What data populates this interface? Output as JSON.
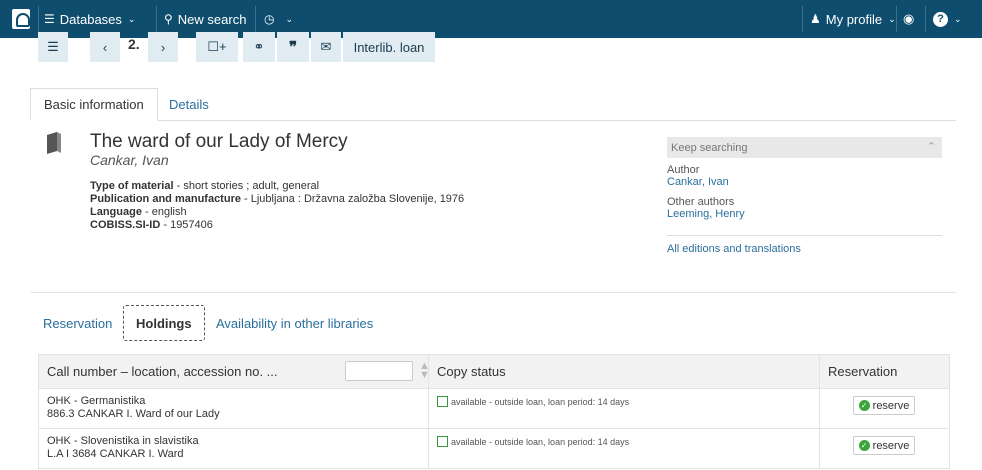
{
  "nav": {
    "databases": "Databases",
    "new_search": "New search",
    "my_profile": "My profile"
  },
  "toolbar": {
    "page": "2.",
    "interlib": "Interlib. loan"
  },
  "tabs_top": [
    "Basic information",
    "Details"
  ],
  "record": {
    "title": "The ward of our Lady of Mercy",
    "author": "Cankar, Ivan",
    "meta": [
      {
        "label": "Type of material",
        "value": " - short stories ; adult, general"
      },
      {
        "label": "Publication and manufacture",
        "value": " - Ljubljana : Državna založba Slovenije, 1976"
      },
      {
        "label": "Language",
        "value": " - english"
      },
      {
        "label": "COBISS.SI-ID",
        "value": " - 1957406"
      }
    ]
  },
  "side_panel": {
    "keep_searching": "Keep searching",
    "author_label": "Author",
    "author": "Cankar, Ivan",
    "other_label": "Other authors",
    "other": "Leeming, Henry",
    "all_editions": "All editions and translations"
  },
  "tabs_bottom": [
    "Reservation",
    "Holdings",
    "Availability in other libraries"
  ],
  "table": {
    "headers": [
      "Call number – location, accession no. ...",
      "Copy status",
      "Reservation"
    ],
    "rows": [
      {
        "loc1": "OHK - Germanistika",
        "loc2": "886.3 CANKAR I. Ward of our Lady",
        "status": "available - outside loan, loan period: 14 days",
        "action": "reserve"
      },
      {
        "loc1": "OHK - Slovenistika in slavistika",
        "loc2": " L.A I 3684 CANKAR I. Ward",
        "status": "available - outside loan, loan period: 14 days",
        "action": "reserve"
      }
    ]
  },
  "colors": {
    "navbar": "#0e4d6e",
    "link": "#2a6f9c",
    "toolbar_button": "#e1ebf2",
    "available": "#3aa63a"
  }
}
